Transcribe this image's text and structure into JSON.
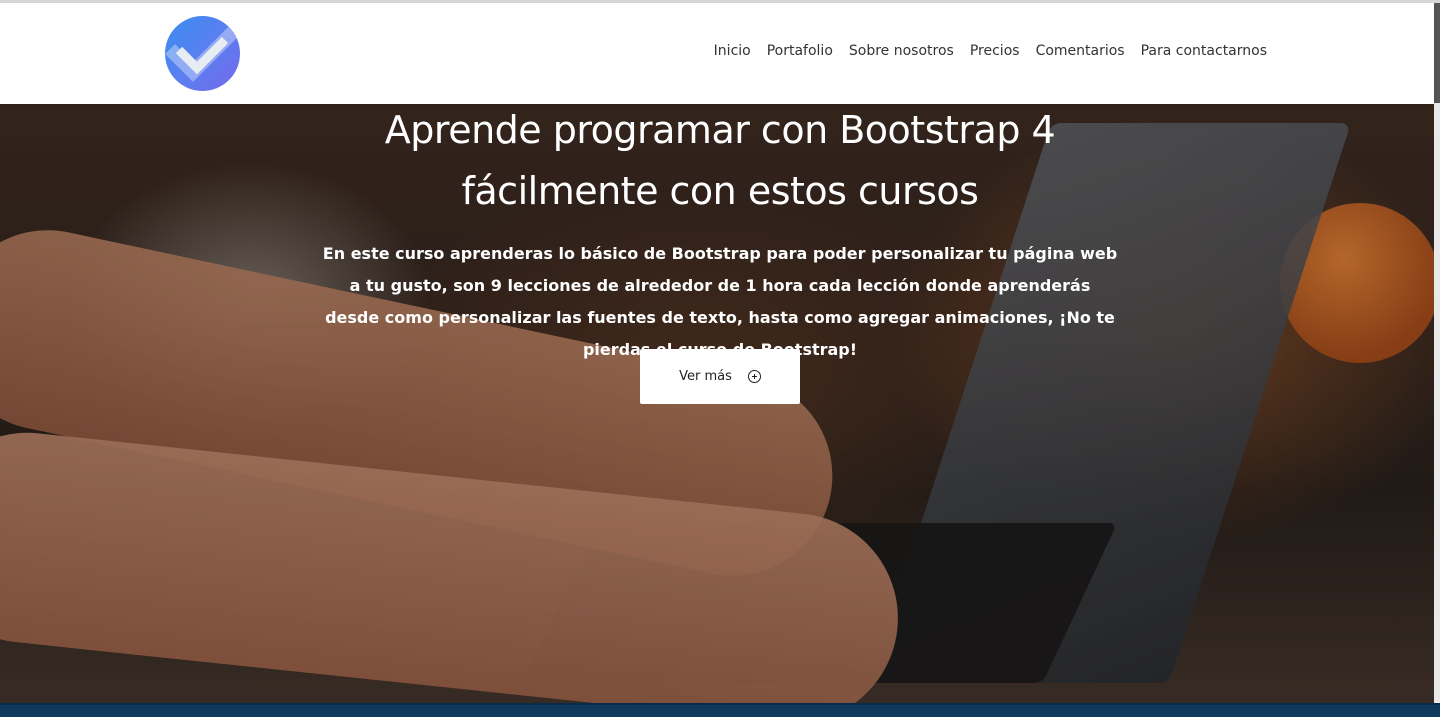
{
  "navbar": {
    "logo_icon": "check-logo-icon",
    "links": [
      "Inicio",
      "Portafolio",
      "Sobre nosotros",
      "Precios",
      "Comentarios",
      "Para contactarnos"
    ]
  },
  "hero": {
    "title": "Aprende programar con Bootstrap 4 fácilmente con estos cursos",
    "description": "En este curso aprenderas lo básico de Bootstrap para poder personalizar tu página web a tu gusto, son 9 lecciones de alrededor de 1 hora cada lección donde aprenderás desde como personalizar las fuentes de texto, hasta como agregar animaciones, ¡No te pierdas el curso de Bootstrap!",
    "cta_label": "Ver más",
    "cta_icon": "plus-circle-icon",
    "background_image": "hands-typing-on-laptop"
  },
  "colors": {
    "navbar_bg": "#ffffff",
    "logo_gradient_start": "#3a8df1",
    "logo_gradient_end": "#7468ec",
    "hero_text": "#ffffff",
    "button_bg": "#ffffff"
  }
}
